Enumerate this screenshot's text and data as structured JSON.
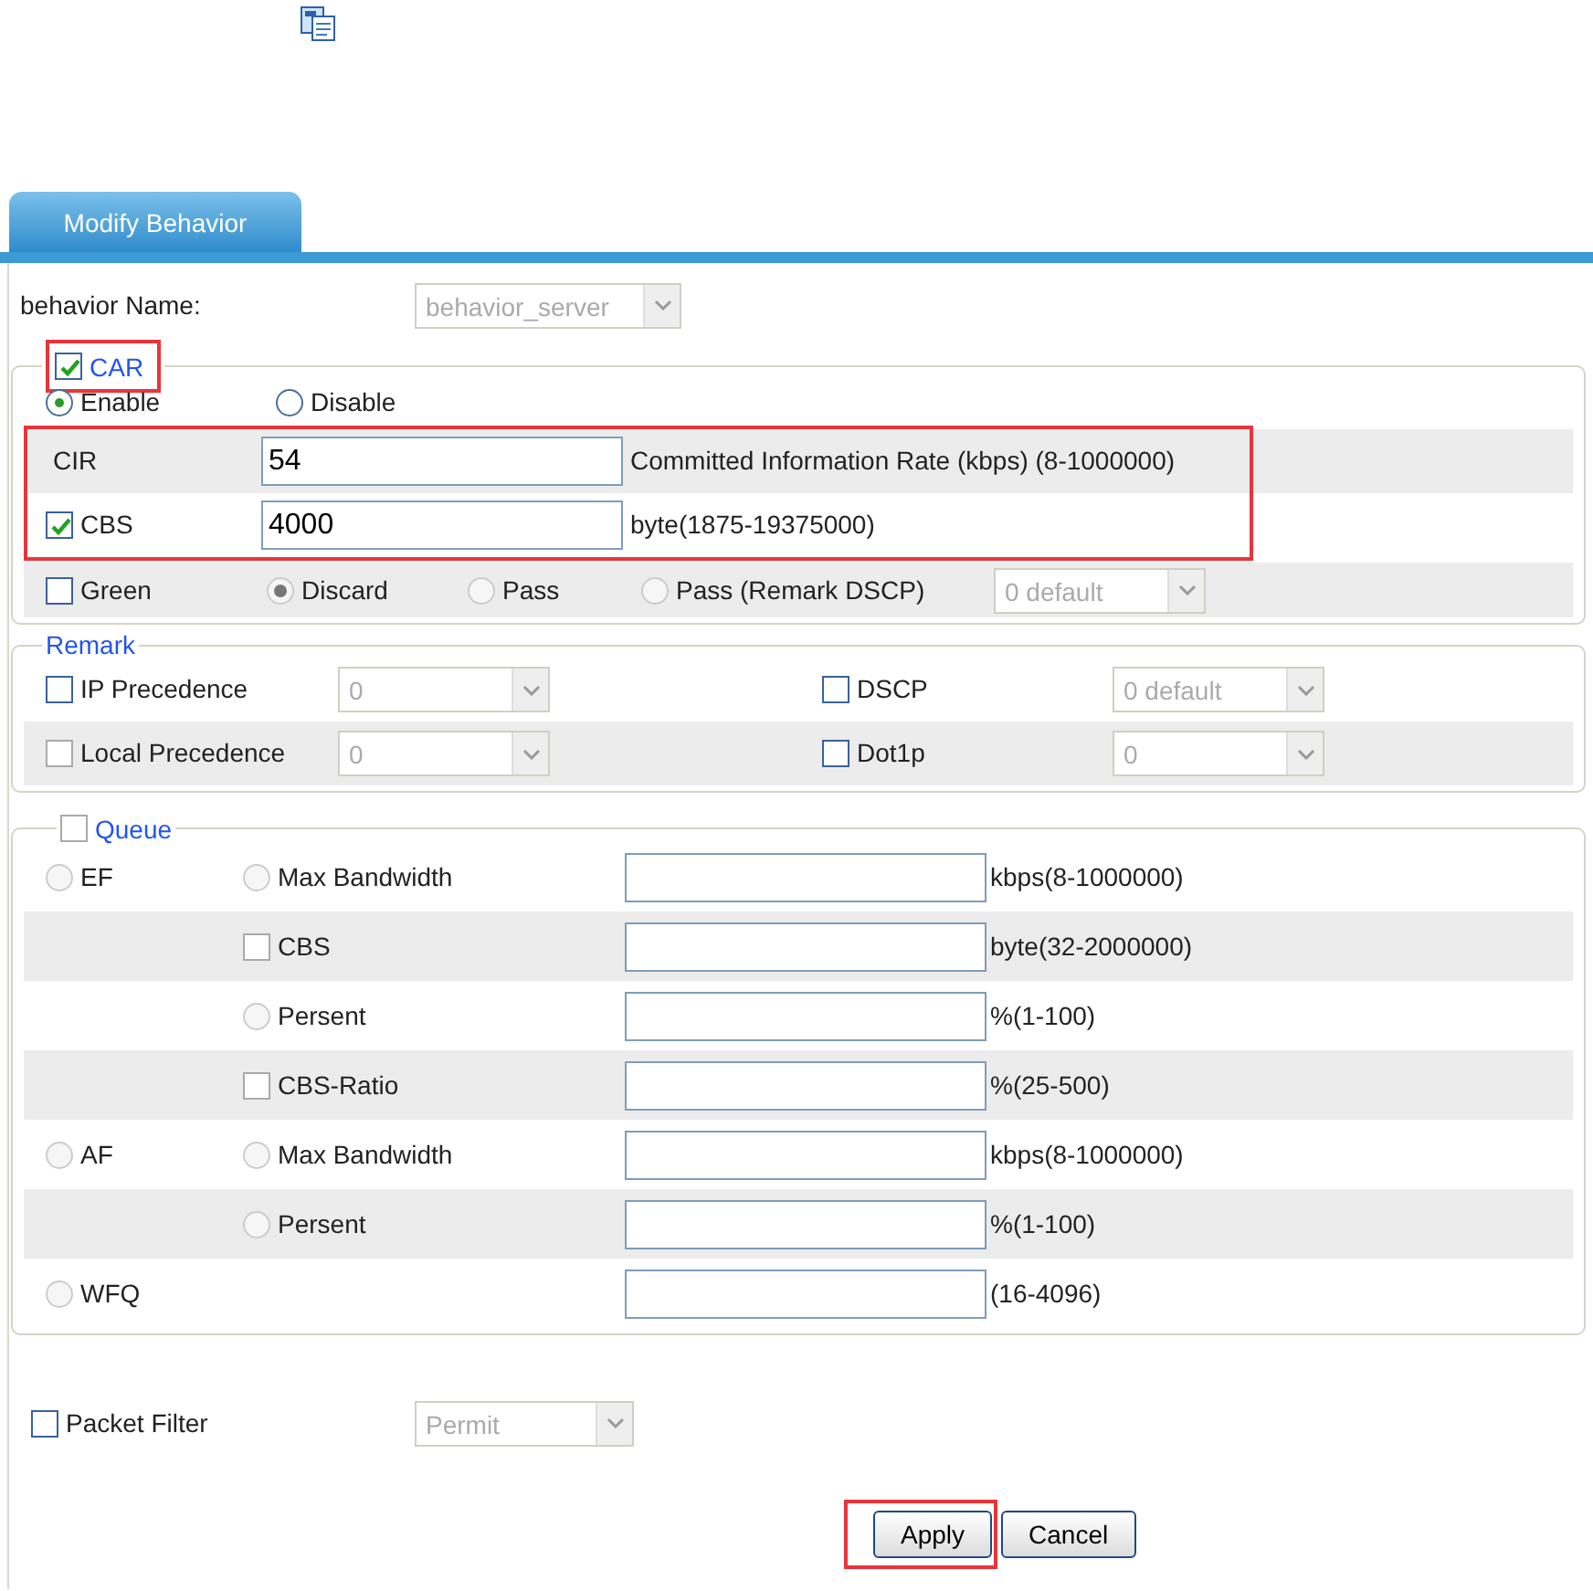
{
  "tab": {
    "label": "Modify Behavior",
    "selected": true
  },
  "behavior_name": {
    "label": "behavior Name:",
    "value": "behavior_server",
    "disabled": true
  },
  "car": {
    "label": "CAR",
    "checked": true,
    "highlighted": true,
    "rates_highlighted": true,
    "modes": [
      {
        "label": "Enable",
        "selected": true
      },
      {
        "label": "Disable",
        "selected": false
      }
    ],
    "cir": {
      "label": "CIR",
      "value": "54",
      "hint": "Committed Information Rate (kbps) (8-1000000)"
    },
    "cbs": {
      "label": "CBS",
      "checked": true,
      "value": "4000",
      "hint": "byte(1875-19375000)"
    },
    "green": {
      "label": "Green",
      "checked": false,
      "actions": [
        {
          "label": "Discard",
          "selected": true,
          "disabled": true
        },
        {
          "label": "Pass",
          "selected": false,
          "disabled": true
        },
        {
          "label": "Pass (Remark DSCP)",
          "selected": false,
          "disabled": true
        }
      ],
      "dscp": {
        "value": "0 default",
        "disabled": true
      }
    }
  },
  "remark": {
    "label": "Remark",
    "rows": [
      [
        {
          "label": "IP Precedence",
          "checked": false,
          "disabled": false,
          "value": "0"
        },
        {
          "label": "DSCP",
          "checked": false,
          "disabled": false,
          "value": "0 default"
        }
      ],
      [
        {
          "label": "Local Precedence",
          "checked": false,
          "disabled": true,
          "value": "0"
        },
        {
          "label": "Dot1p",
          "checked": false,
          "disabled": false,
          "value": "0"
        }
      ]
    ]
  },
  "queue": {
    "label": "Queue",
    "checked": false,
    "disabled": true,
    "rows": [
      {
        "mode": {
          "label": "EF",
          "selected": false
        },
        "option": {
          "kind": "radio",
          "label": "Max Bandwidth",
          "checked": false
        },
        "range": "kbps(8-1000000)"
      },
      {
        "option": {
          "kind": "checkbox",
          "label": "CBS",
          "checked": false
        },
        "range": "byte(32-2000000)"
      },
      {
        "option": {
          "kind": "radio",
          "label": "Persent",
          "checked": false
        },
        "range": "%(1-100)"
      },
      {
        "option": {
          "kind": "checkbox",
          "label": "CBS-Ratio",
          "checked": false
        },
        "range": "%(25-500)"
      },
      {
        "mode": {
          "label": "AF",
          "selected": false
        },
        "option": {
          "kind": "radio",
          "label": "Max Bandwidth",
          "checked": false
        },
        "range": "kbps(8-1000000)"
      },
      {
        "option": {
          "kind": "radio",
          "label": "Persent",
          "checked": false
        },
        "range": "%(1-100)"
      },
      {
        "mode": {
          "label": "WFQ",
          "selected": false
        },
        "range": "(16-4096)"
      }
    ]
  },
  "packet_filter": {
    "label": "Packet Filter",
    "checked": false,
    "value": "Permit",
    "disabled": true
  },
  "buttons": [
    {
      "label": "Apply",
      "highlighted": true
    },
    {
      "label": "Cancel",
      "highlighted": false
    }
  ]
}
